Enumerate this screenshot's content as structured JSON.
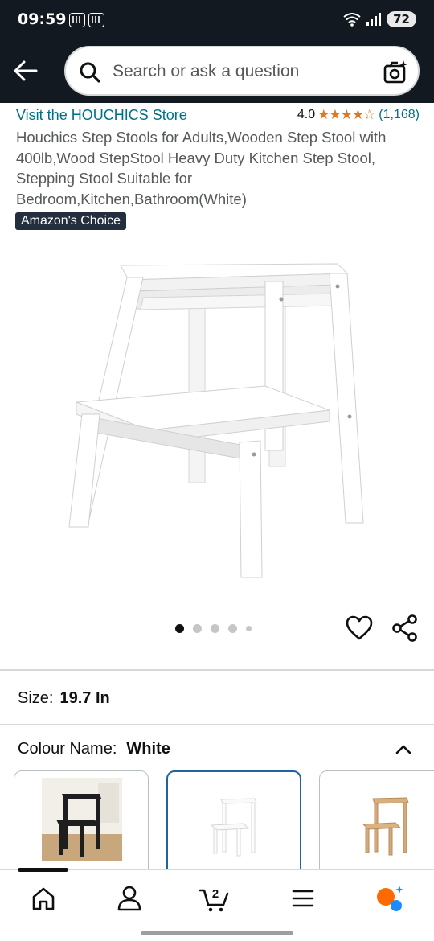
{
  "status_bar": {
    "time": "09:59",
    "battery": "72"
  },
  "search": {
    "placeholder": "Search or ask a question"
  },
  "product": {
    "store_link": "Visit the HOUCHICS Store",
    "rating_value": "4.0",
    "rating_stars": "★★★★☆",
    "rating_count": "(1,168)",
    "title": "Houchics Step Stools for Adults,Wooden Step Stool with 400lb,Wood StepStool Heavy Duty Kitchen Step Stool, Stepping Stool Suitable for Bedroom,Kitchen,Bathroom(White)",
    "badge": "Amazon's Choice",
    "image_count": 5,
    "active_image": 1
  },
  "size": {
    "label": "Size:",
    "value": "19.7 In"
  },
  "colour": {
    "label": "Colour Name:",
    "value": "White",
    "options": [
      "black",
      "white",
      "natural wood"
    ],
    "selected_index": 1
  },
  "colors": {
    "header_bg": "#131921",
    "link": "#007185",
    "star": "#de7921",
    "badge_bg": "#232f3e",
    "selected_border": "#2162a1"
  },
  "bottom_nav": {
    "items": [
      "home-icon",
      "account-icon",
      "cart-icon",
      "menu-icon",
      "rufus-ai-icon"
    ],
    "cart_count": "2"
  }
}
